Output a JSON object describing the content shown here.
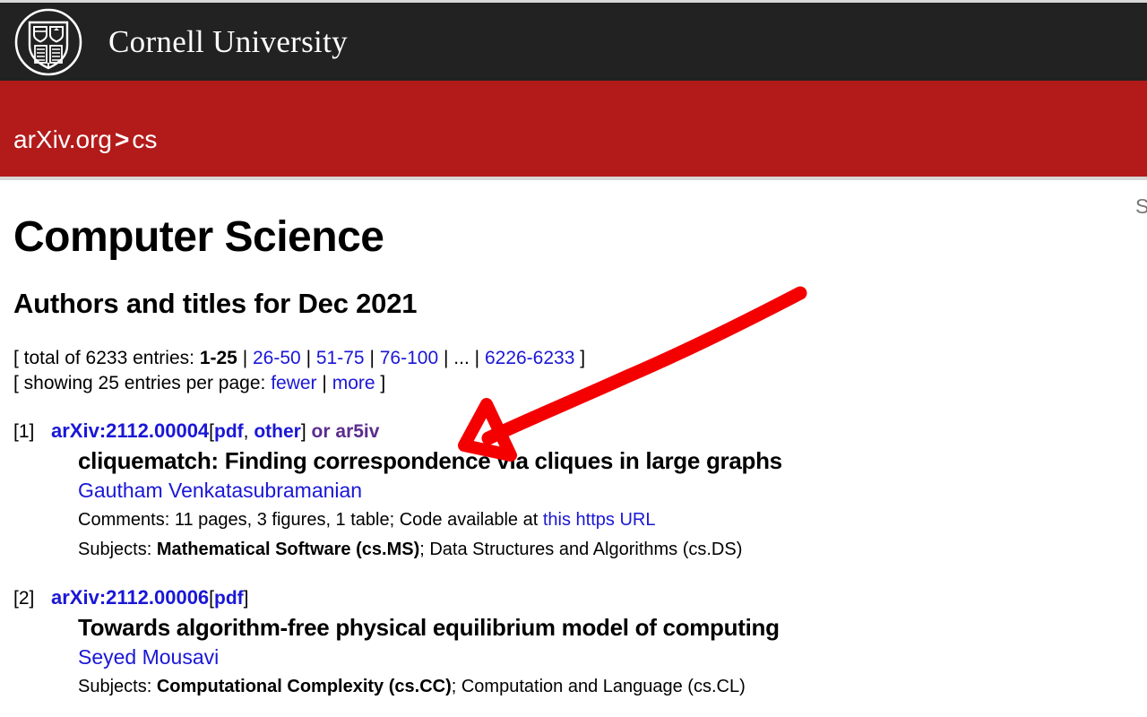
{
  "header": {
    "institution": "Cornell University",
    "seal_icon": "cornell-seal-icon"
  },
  "banner": {
    "site_name": "arXiv.org",
    "separator": ">",
    "archive": "cs",
    "search": {
      "placeholder": "Search...",
      "value": ""
    }
  },
  "main": {
    "title": "Computer Science",
    "subtitle": "Authors and titles for Dec 2021",
    "paging": {
      "total_prefix": "[ total of 6233 entries:",
      "current_range": "1-25",
      "ranges": [
        "26-50",
        "51-75",
        "76-100"
      ],
      "ellipsis": "...",
      "last_range": "6226-6233",
      "close_bracket": "]",
      "per_page_prefix": "[ showing 25 entries per page:",
      "fewer": "fewer",
      "more": "more",
      "pipe": "|"
    },
    "entries": [
      {
        "number": "[1]",
        "arxiv_id": "arXiv:2112.00004",
        "open_bracket": "[",
        "pdf": "pdf",
        "comma": ",",
        "other": "other",
        "close_bracket": "]",
        "or_text": "or",
        "ar5iv": "ar5iv",
        "title": "cliquematch: Finding correspondence via cliques in large graphs",
        "authors": "Gautham Venkatasubramanian",
        "comments_label": "Comments:",
        "comments_text": "11 pages, 3 figures, 1 table; Code available at",
        "comments_link": "this https URL",
        "subjects_label": "Subjects:",
        "subjects_primary": "Mathematical Software (cs.MS)",
        "subjects_rest": "; Data Structures and Algorithms (cs.DS)"
      },
      {
        "number": "[2]",
        "arxiv_id": "arXiv:2112.00006",
        "open_bracket": "[",
        "pdf": "pdf",
        "close_bracket": "]",
        "title": "Towards algorithm-free physical equilibrium model of computing",
        "authors": "Seyed Mousavi",
        "subjects_label": "Subjects:",
        "subjects_primary": "Computational Complexity (cs.CC)",
        "subjects_rest": "; Computation and Language (cs.CL)"
      }
    ]
  },
  "annotation": {
    "type": "red-arrow",
    "color": "#f50000",
    "points_to": "pdf-other-links-entry-1"
  },
  "colors": {
    "cornell_dark": "#222222",
    "arxiv_red": "#b31b1b",
    "link_blue": "#1a17d6",
    "visited_purple": "#5b2d8e",
    "annotation_red": "#f50000"
  }
}
